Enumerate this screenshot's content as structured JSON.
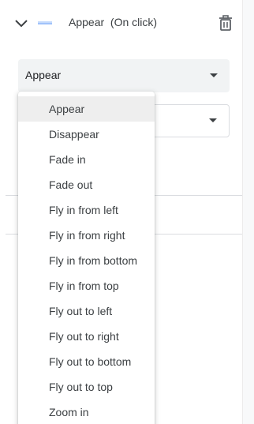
{
  "header": {
    "title": "Appear  (On click)",
    "chevron_icon": "chevron-down-icon",
    "thumb_icon": "animation-thumb-icon",
    "delete_icon": "trash-icon"
  },
  "animation_select": {
    "value": "Appear",
    "caret_icon": "caret-down-icon"
  },
  "trigger_select": {
    "value": "",
    "caret_icon": "caret-down-icon"
  },
  "menu": {
    "selected_index": 0,
    "items": [
      {
        "label": "Appear"
      },
      {
        "label": "Disappear"
      },
      {
        "label": "Fade in"
      },
      {
        "label": "Fade out"
      },
      {
        "label": "Fly in from left"
      },
      {
        "label": "Fly in from right"
      },
      {
        "label": "Fly in from bottom"
      },
      {
        "label": "Fly in from top"
      },
      {
        "label": "Fly out to left"
      },
      {
        "label": "Fly out to right"
      },
      {
        "label": "Fly out to bottom"
      },
      {
        "label": "Fly out to top"
      },
      {
        "label": "Zoom in"
      }
    ]
  },
  "colors": {
    "accent": "#4285f4",
    "text": "#3c4043",
    "select_bg": "#f1f3f4",
    "selected_item_bg": "#eeeeee",
    "divider": "#dadce0"
  }
}
